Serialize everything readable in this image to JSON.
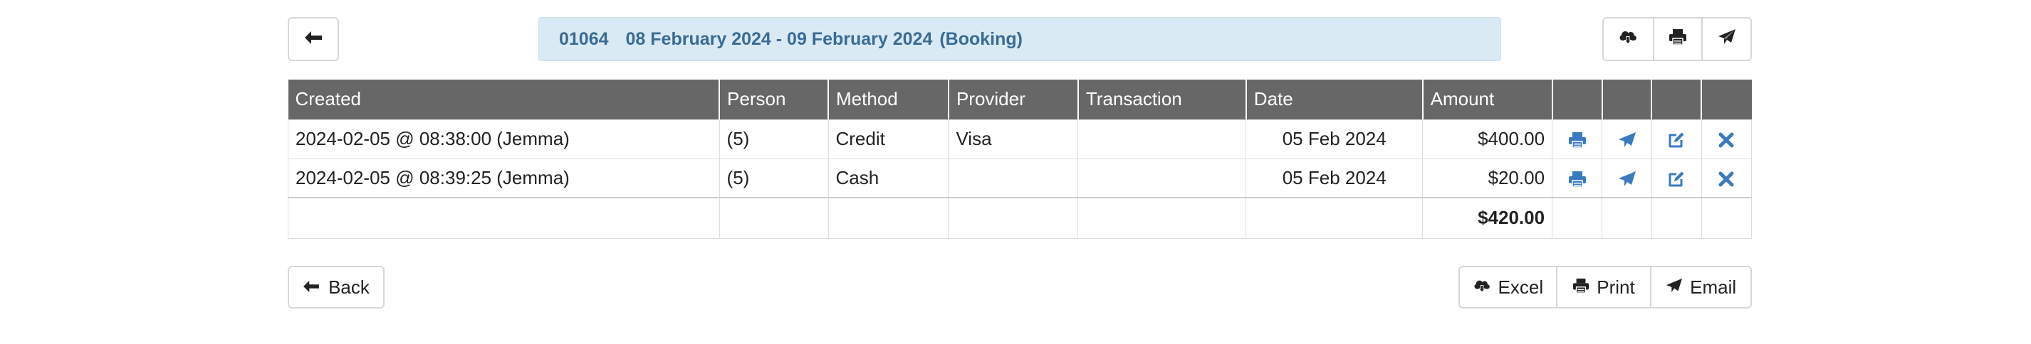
{
  "header": {
    "booking_code": "01064",
    "date_range": "08 February 2024 - 09 February 2024",
    "type": "(Booking)"
  },
  "table": {
    "columns": [
      "Created",
      "Person",
      "Method",
      "Provider",
      "Transaction",
      "Date",
      "Amount"
    ],
    "rows": [
      {
        "created": "2024-02-05 @ 08:38:00 (Jemma)",
        "person": "(5)",
        "method": "Credit",
        "provider": "Visa",
        "transaction": "",
        "date": "05 Feb 2024",
        "amount": "$400.00"
      },
      {
        "created": "2024-02-05 @ 08:39:25 (Jemma)",
        "person": "(5)",
        "method": "Cash",
        "provider": "",
        "transaction": "",
        "date": "05 Feb 2024",
        "amount": "$20.00"
      }
    ],
    "total": "$420.00"
  },
  "footer": {
    "back_label": "Back",
    "excel_label": "Excel",
    "print_label": "Print",
    "email_label": "Email"
  },
  "icons": {
    "back": "arrow-left-icon",
    "download": "cloud-download-icon",
    "print": "printer-icon",
    "email": "paper-plane-icon",
    "edit": "edit-icon",
    "delete": "close-icon"
  },
  "colors": {
    "header_bg": "#676767",
    "banner_bg": "#d9eaf4",
    "banner_text": "#3a6b94",
    "action_icon": "#3a7bbf"
  }
}
